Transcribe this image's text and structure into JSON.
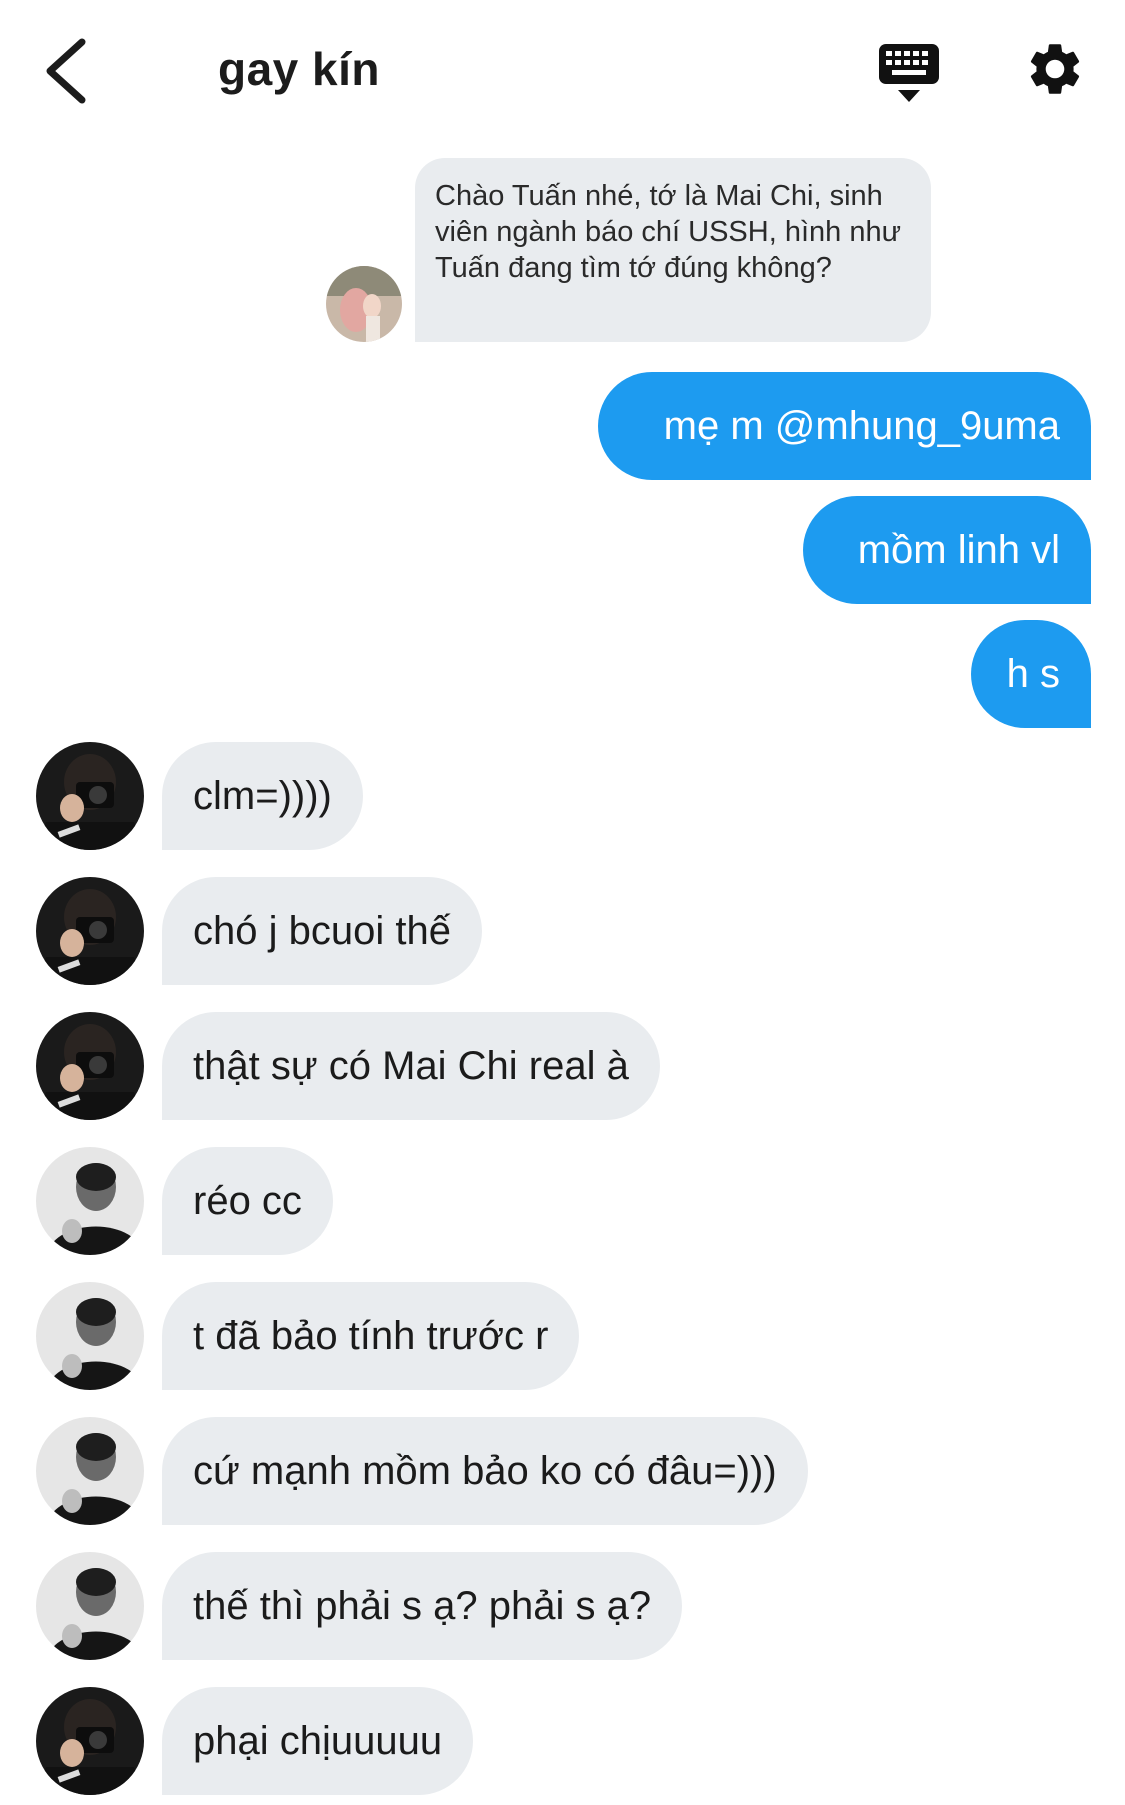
{
  "header": {
    "title": "gay kín",
    "back_icon": "chevron-left-icon",
    "keyboard_icon": "keyboard-icon",
    "settings_icon": "gear-icon"
  },
  "colors": {
    "outgoing_bubble": "#1d9bf0",
    "incoming_bubble": "#e9ecef",
    "header_text": "#1c1c1c"
  },
  "shared_post": {
    "text": "Chào Tuấn nhé, tớ là Mai Chi, sinh viên ngành báo chí USSH, hình như Tuấn đang tìm tớ đúng không?"
  },
  "outgoing": [
    {
      "text": "mẹ m @mhung_9uma"
    },
    {
      "text": "mồm linh vl"
    },
    {
      "text": "h s"
    }
  ],
  "incoming": [
    {
      "text": "clm=))))",
      "sender": "user-camera"
    },
    {
      "text": "chó j bcuoi thế",
      "sender": "user-camera"
    },
    {
      "text": "thật sự có Mai Chi real à",
      "sender": "user-camera"
    },
    {
      "text": "réo cc",
      "sender": "user-bw"
    },
    {
      "text": "t đã bảo tính trước r",
      "sender": "user-bw"
    },
    {
      "text": "cứ mạnh mồm bảo ko có đâu=)))",
      "sender": "user-bw"
    },
    {
      "text": "thế thì phải s ạ? phải s ạ?",
      "sender": "user-bw"
    },
    {
      "text": "phại chịuuuuu",
      "sender": "user-camera"
    }
  ]
}
